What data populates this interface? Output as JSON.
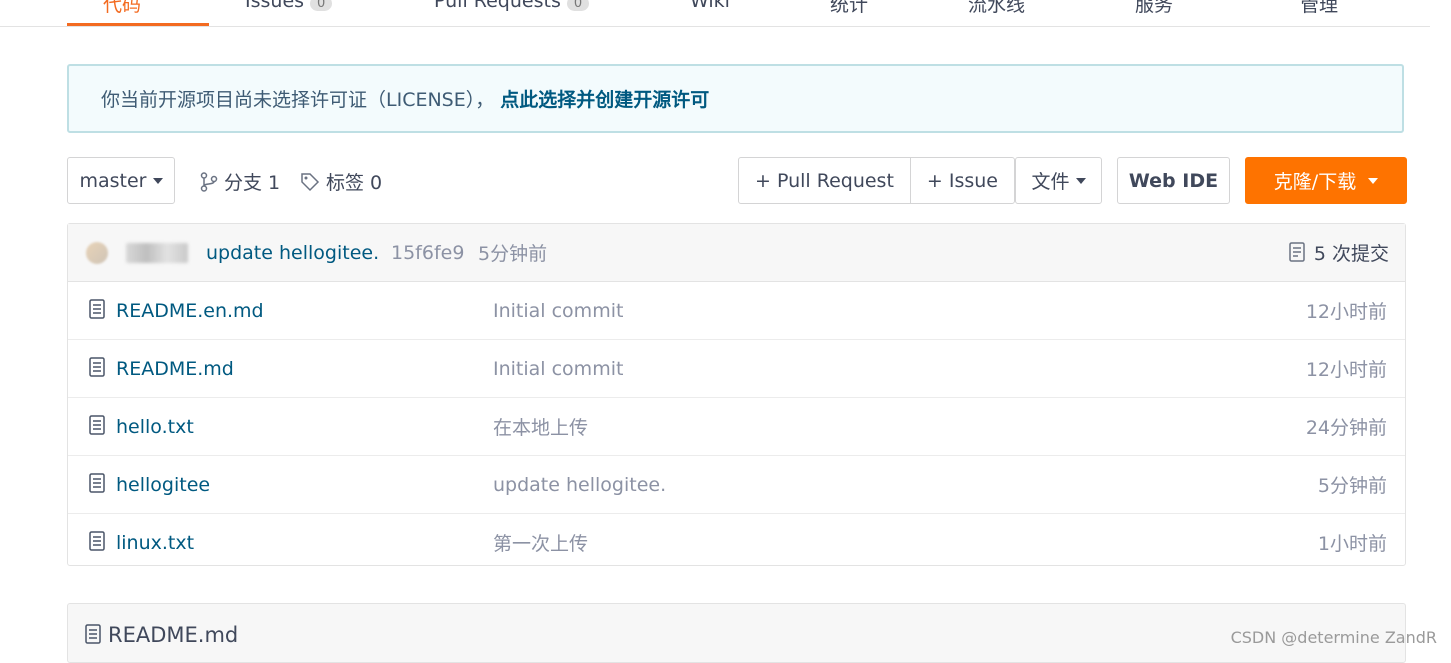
{
  "tabs": [
    {
      "label": "代码",
      "active": true
    },
    {
      "label": "Issues",
      "count": "0"
    },
    {
      "label": "Pull Requests",
      "count": "0"
    },
    {
      "label": "Wiki"
    },
    {
      "label": "统计"
    },
    {
      "label": "流水线"
    },
    {
      "label": "服务"
    },
    {
      "label": "管理"
    }
  ],
  "license_notice": {
    "message": "你当前开源项目尚未选择许可证（LICENSE），",
    "link": "点此选择并创建开源许可"
  },
  "toolbar": {
    "branch": "master",
    "branches_label": "分支 1",
    "tags_label": "标签 0",
    "pull_request": "+ Pull Request",
    "issue": "+ Issue",
    "file_menu": "文件",
    "web_ide": "Web IDE",
    "clone": "克隆/下载"
  },
  "last_commit": {
    "message": "update hellogitee.",
    "sha": "15f6fe9",
    "time": "5分钟前",
    "commit_count": "5 次提交"
  },
  "files": [
    {
      "name": "README.en.md",
      "message": "Initial commit",
      "time": "12小时前"
    },
    {
      "name": "README.md",
      "message": "Initial commit",
      "time": "12小时前"
    },
    {
      "name": "hello.txt",
      "message": "在本地上传",
      "time": "24分钟前"
    },
    {
      "name": "hellogitee",
      "message": "update hellogitee.",
      "time": "5分钟前"
    },
    {
      "name": "linux.txt",
      "message": "第一次上传",
      "time": "1小时前"
    }
  ],
  "readme": {
    "title": "README.md"
  },
  "watermark": "CSDN @determine  ZandR",
  "colors": {
    "accent": "#fe7300",
    "link": "#005980",
    "tab_active": "#f36b21"
  }
}
